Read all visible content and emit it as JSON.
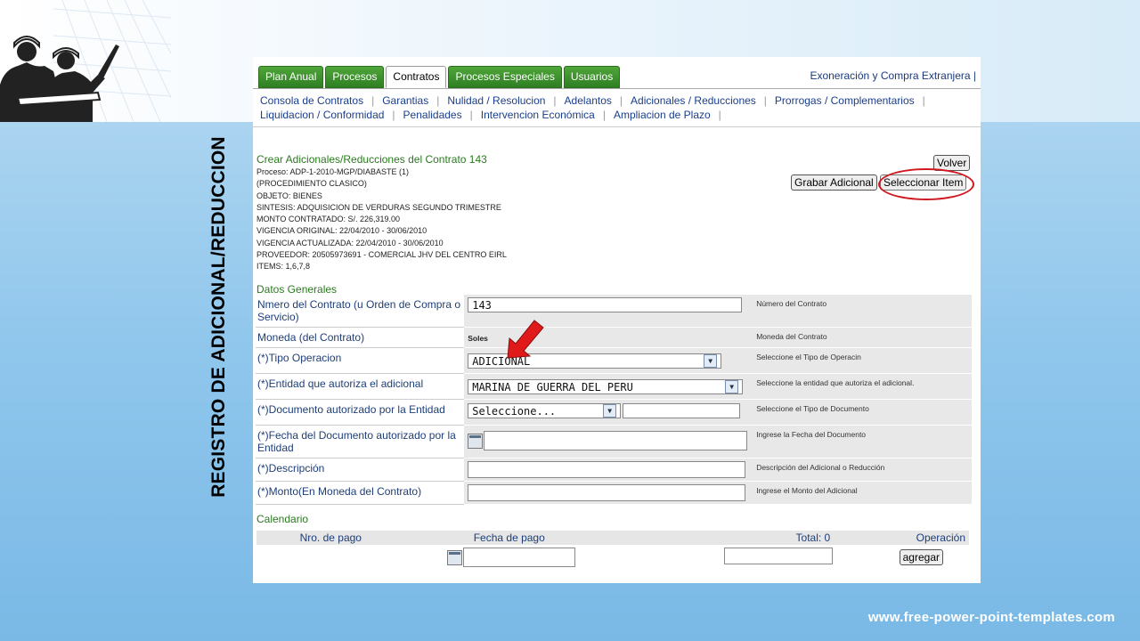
{
  "slide": {
    "vertical_title": "REGISTRO DE ADICIONAL/REDUCCION",
    "footer_url": "www.free-power-point-templates.com"
  },
  "tabs": [
    "Plan Anual",
    "Procesos",
    "Contratos",
    "Procesos Especiales",
    "Usuarios"
  ],
  "active_tab": "Contratos",
  "tab_right": "Exoneración y Compra Extranjera |",
  "subnav": {
    "row1": [
      "Consola de Contratos",
      "Garantias",
      "Nulidad / Resolucion",
      "Adelantos",
      "Adicionales / Reducciones",
      "Prorrogas / Complementarios"
    ],
    "row2": [
      "Liquidacion / Conformidad",
      "Penalidades",
      "Intervencion Económica",
      "Ampliacion de Plazo"
    ]
  },
  "contract": {
    "title": "Crear Adicionales/Reducciones del Contrato 143",
    "lines": [
      "Proceso: ADP-1-2010-MGP/DIABASTE (1)",
      "(PROCEDIMIENTO CLASICO)",
      "OBJETO: BIENES",
      "SINTESIS: ADQUISICION DE VERDURAS SEGUNDO TRIMESTRE",
      "MONTO CONTRATADO: S/. 226,319.00",
      "VIGENCIA ORIGINAL: 22/04/2010 - 30/06/2010",
      "VIGENCIA ACTUALIZADA: 22/04/2010 - 30/06/2010",
      "PROVEEDOR: 20505973691 - COMERCIAL JHV DEL CENTRO EIRL",
      "ITEMS: 1,6,7,8"
    ]
  },
  "buttons": {
    "volver": "Volver",
    "grabar": "Grabar Adicional",
    "seleccionar": "Seleccionar Item",
    "agregar": "agregar"
  },
  "datos_generales": {
    "title": "Datos Generales",
    "rows": {
      "numero": {
        "label": "Nmero del Contrato (u Orden de Compra o Servicio)",
        "value": "143",
        "hint": "Número del Contrato"
      },
      "moneda": {
        "label": "Moneda (del Contrato)",
        "value": "Soles",
        "hint": "Moneda del Contrato"
      },
      "tipo": {
        "label": "(*)Tipo Operacion",
        "value": "ADICIONAL",
        "hint": "Seleccione el Tipo de Operacin"
      },
      "entidad": {
        "label": "(*)Entidad que autoriza el adicional",
        "value": "MARINA DE GUERRA DEL PERU",
        "hint": "Seleccione la entidad que autoriza el adicional."
      },
      "documento": {
        "label": "(*)Documento autorizado por la Entidad",
        "value": "Seleccione...",
        "hint": "Seleccione el Tipo de Documento"
      },
      "fecha": {
        "label": "(*)Fecha del Documento autorizado por la Entidad",
        "value": "",
        "hint": "Ingrese la Fecha del Documento"
      },
      "descripcion": {
        "label": "(*)Descripción",
        "value": "",
        "hint": "Descripción del Adicional o Reducción"
      },
      "monto": {
        "label": "(*)Monto(En Moneda del Contrato)",
        "value": "",
        "hint": "Ingrese el Monto del Adicional"
      }
    }
  },
  "calendario": {
    "title": "Calendario",
    "headers": [
      "Nro. de pago",
      "Fecha de pago",
      "Total: 0",
      "Operación"
    ]
  },
  "colors": {
    "tab_green": "#2f7f22",
    "section_green": "#2a7a1f",
    "link_blue": "#1a3e8c",
    "highlight_red": "#d0181f"
  }
}
